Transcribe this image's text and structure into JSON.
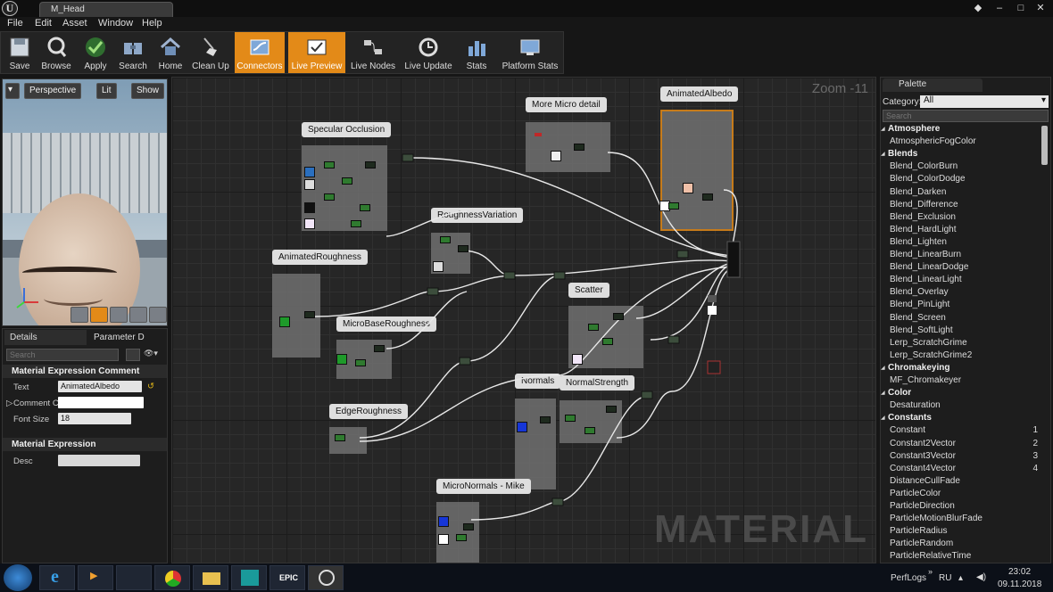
{
  "window": {
    "asset_tab": "M_Head"
  },
  "menu": [
    "File",
    "Edit",
    "Asset",
    "Window",
    "Help"
  ],
  "toolbar": [
    {
      "label": "Save",
      "icon": "save-icon"
    },
    {
      "label": "Browse",
      "icon": "browse-icon"
    },
    {
      "label": "Apply",
      "icon": "apply-icon"
    },
    {
      "label": "Search",
      "icon": "search-icon"
    },
    {
      "label": "Home",
      "icon": "home-icon"
    },
    {
      "label": "Clean Up",
      "icon": "clean-up-icon"
    },
    {
      "label": "Connectors",
      "icon": "connectors-icon",
      "active": true
    },
    {
      "label": "Live Preview",
      "icon": "live-preview-icon",
      "active": true
    },
    {
      "label": "Live Nodes",
      "icon": "live-nodes-icon"
    },
    {
      "label": "Live Update",
      "icon": "live-update-icon"
    },
    {
      "label": "Stats",
      "icon": "stats-icon"
    },
    {
      "label": "Platform Stats",
      "icon": "platform-stats-icon"
    }
  ],
  "viewport": {
    "perspective": "Perspective",
    "lit": "Lit",
    "show": "Show"
  },
  "details": {
    "tab_details": "Details",
    "tab_parameter": "Parameter D",
    "search_placeholder": "Search",
    "section_comment": "Material Expression Comment",
    "text_label": "Text",
    "text_value": "AnimatedAlbedo",
    "comment_label": "Comment C",
    "comment_value": "",
    "font_size_label": "Font Size",
    "font_size_value": "18",
    "section_expression": "Material Expression",
    "desc_label": "Desc",
    "desc_value": ""
  },
  "graph": {
    "zoom": "Zoom -11",
    "watermark": "MATERIAL",
    "comments": [
      "Specular Occlusion",
      "More Micro detail",
      "AnimatedAlbedo",
      "RoughnessVariation",
      "AnimatedRoughness",
      "MicroBaseRoughness",
      "Scatter",
      "EdgeRoughness",
      "Normals",
      "NormalStrength",
      "MicroNormals - Mike"
    ]
  },
  "palette": {
    "tab": "Palette",
    "category_label": "Category:",
    "category_value": "All",
    "search_placeholder": "Search",
    "entries": [
      {
        "t": "cat",
        "label": "Atmosphere"
      },
      {
        "t": "item",
        "label": "AtmosphericFogColor"
      },
      {
        "t": "cat",
        "label": "Blends"
      },
      {
        "t": "item",
        "label": "Blend_ColorBurn"
      },
      {
        "t": "item",
        "label": "Blend_ColorDodge"
      },
      {
        "t": "item",
        "label": "Blend_Darken"
      },
      {
        "t": "item",
        "label": "Blend_Difference"
      },
      {
        "t": "item",
        "label": "Blend_Exclusion"
      },
      {
        "t": "item",
        "label": "Blend_HardLight"
      },
      {
        "t": "item",
        "label": "Blend_Lighten"
      },
      {
        "t": "item",
        "label": "Blend_LinearBurn"
      },
      {
        "t": "item",
        "label": "Blend_LinearDodge"
      },
      {
        "t": "item",
        "label": "Blend_LinearLight"
      },
      {
        "t": "item",
        "label": "Blend_Overlay"
      },
      {
        "t": "item",
        "label": "Blend_PinLight"
      },
      {
        "t": "item",
        "label": "Blend_Screen"
      },
      {
        "t": "item",
        "label": "Blend_SoftLight"
      },
      {
        "t": "item",
        "label": "Lerp_ScratchGrime"
      },
      {
        "t": "item",
        "label": "Lerp_ScratchGrime2"
      },
      {
        "t": "cat",
        "label": "Chromakeying"
      },
      {
        "t": "item",
        "label": "MF_Chromakeyer"
      },
      {
        "t": "cat",
        "label": "Color"
      },
      {
        "t": "item",
        "label": "Desaturation"
      },
      {
        "t": "cat",
        "label": "Constants"
      },
      {
        "t": "item",
        "label": "Constant",
        "num": "1"
      },
      {
        "t": "item",
        "label": "Constant2Vector",
        "num": "2"
      },
      {
        "t": "item",
        "label": "Constant3Vector",
        "num": "3"
      },
      {
        "t": "item",
        "label": "Constant4Vector",
        "num": "4"
      },
      {
        "t": "item",
        "label": "DistanceCullFade"
      },
      {
        "t": "item",
        "label": "ParticleColor"
      },
      {
        "t": "item",
        "label": "ParticleDirection"
      },
      {
        "t": "item",
        "label": "ParticleMotionBlurFade"
      },
      {
        "t": "item",
        "label": "ParticleRadius"
      },
      {
        "t": "item",
        "label": "ParticleRandom"
      },
      {
        "t": "item",
        "label": "ParticleRelativeTime"
      }
    ]
  },
  "taskbar": {
    "folder": "PerfLogs",
    "lang": "RU",
    "time": "23:02",
    "date": "09.11.2018",
    "epic_label": "EPIC"
  },
  "colors": {
    "accent": "#e38a18",
    "comment_box": "#707070",
    "selected_border": "#e38a18"
  }
}
